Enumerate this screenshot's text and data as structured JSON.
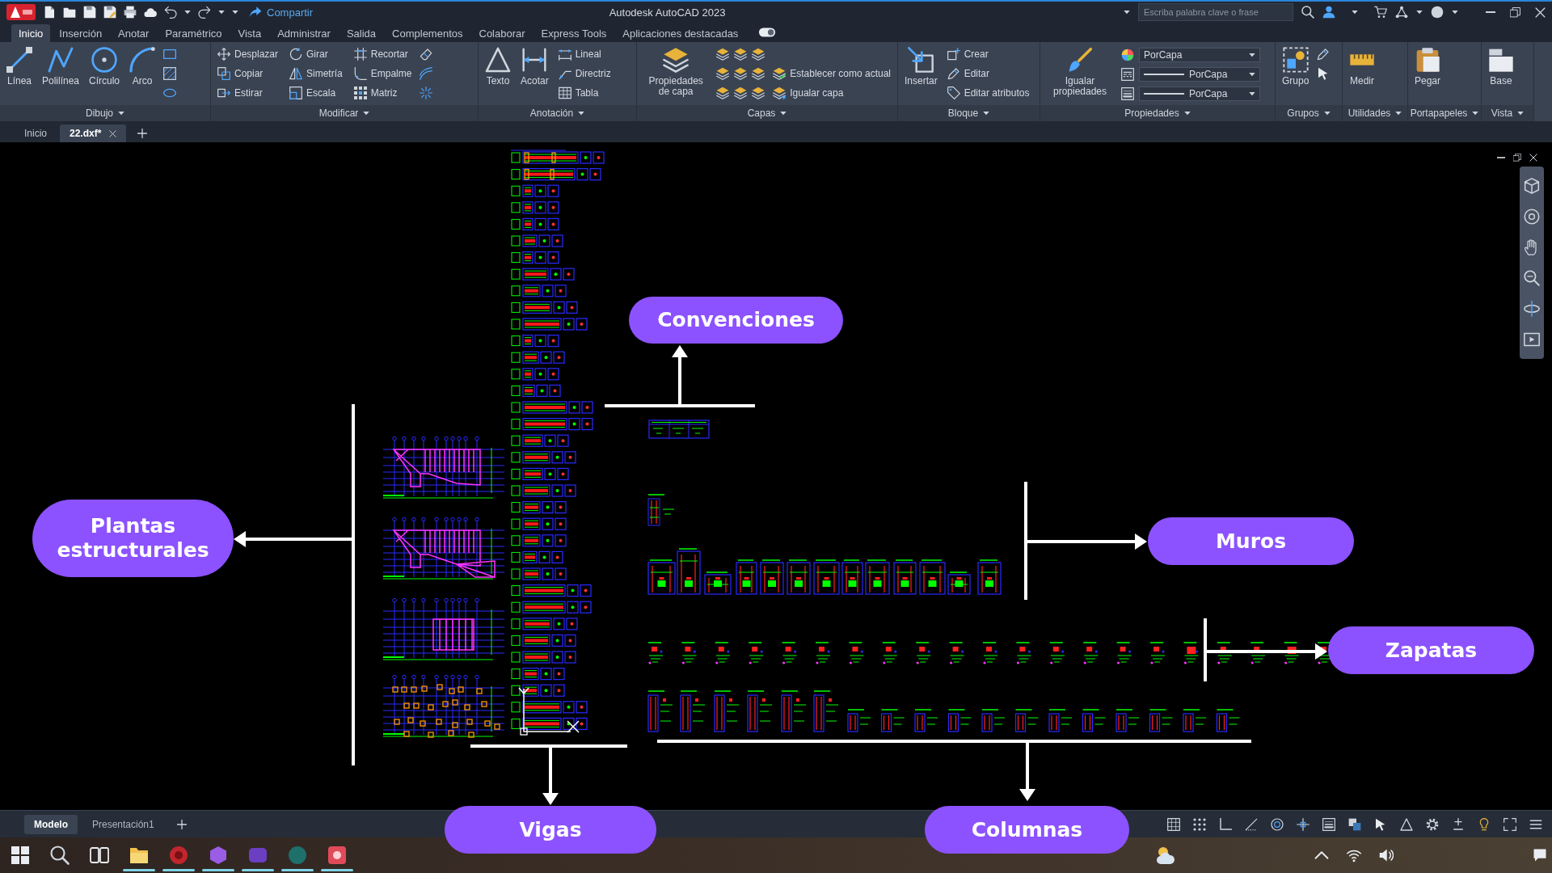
{
  "title_bar": {
    "share_label": "Compartir",
    "title": "Autodesk AutoCAD 2023",
    "search_placeholder": "Escriba palabra clave o frase"
  },
  "ribbon_tabs": [
    {
      "label": "Inicio",
      "selected": true
    },
    {
      "label": "Inserción",
      "selected": false
    },
    {
      "label": "Anotar",
      "selected": false
    },
    {
      "label": "Paramétrico",
      "selected": false
    },
    {
      "label": "Vista",
      "selected": false
    },
    {
      "label": "Administrar",
      "selected": false
    },
    {
      "label": "Salida",
      "selected": false
    },
    {
      "label": "Complementos",
      "selected": false
    },
    {
      "label": "Colaborar",
      "selected": false
    },
    {
      "label": "Express Tools",
      "selected": false
    },
    {
      "label": "Aplicaciones destacadas",
      "selected": false
    }
  ],
  "ribbon_panels": [
    {
      "title": "Dibujo",
      "tools": [
        {
          "kind": "large",
          "label": "Línea"
        },
        {
          "kind": "large",
          "label": "Polilínea"
        },
        {
          "kind": "large",
          "label": "Círculo"
        },
        {
          "kind": "large",
          "label": "Arco"
        }
      ]
    },
    {
      "title": "Modificar",
      "tools": [
        {
          "kind": "small",
          "label": "Desplazar"
        },
        {
          "kind": "small",
          "label": "Copiar"
        },
        {
          "kind": "small",
          "label": "Estirar"
        },
        {
          "kind": "small",
          "label": "Girar"
        },
        {
          "kind": "small",
          "label": "Simetría"
        },
        {
          "kind": "small",
          "label": "Escala"
        },
        {
          "kind": "small",
          "label": "Recortar"
        },
        {
          "kind": "small",
          "label": "Empalme"
        },
        {
          "kind": "small",
          "label": "Matriz"
        }
      ]
    },
    {
      "title": "Anotación",
      "tools": [
        {
          "kind": "large",
          "label": "Texto"
        },
        {
          "kind": "large",
          "label": "Acotar"
        },
        {
          "kind": "small",
          "label": "Lineal"
        },
        {
          "kind": "small",
          "label": "Directriz"
        },
        {
          "kind": "small",
          "label": "Tabla"
        }
      ]
    },
    {
      "title": "Capas",
      "tools": [
        {
          "kind": "large",
          "label": "Propiedades de capa"
        },
        {
          "kind": "small",
          "label": "Establecer como actual"
        },
        {
          "kind": "small",
          "label": "Igualar capa"
        }
      ]
    },
    {
      "title": "Bloque",
      "tools": [
        {
          "kind": "large",
          "label": "Insertar"
        },
        {
          "kind": "small",
          "label": "Crear"
        },
        {
          "kind": "small",
          "label": "Editar"
        },
        {
          "kind": "small",
          "label": "Editar atributos"
        }
      ]
    },
    {
      "title": "Propiedades",
      "tools": [
        {
          "kind": "large",
          "label": "Igualar propiedades"
        },
        {
          "kind": "dropdown",
          "label": "PorCapa"
        },
        {
          "kind": "dropdown",
          "label": "PorCapa"
        },
        {
          "kind": "dropdown",
          "label": "PorCapa"
        }
      ]
    },
    {
      "title": "Grupos",
      "tools": [
        {
          "kind": "large",
          "label": "Grupo"
        }
      ]
    },
    {
      "title": "Utilidades",
      "tools": [
        {
          "kind": "large",
          "label": "Medir"
        }
      ]
    },
    {
      "title": "Portapapeles",
      "tools": [
        {
          "kind": "large",
          "label": "Pegar"
        }
      ]
    },
    {
      "title": "Vista",
      "tools": [
        {
          "kind": "large",
          "label": "Base"
        }
      ]
    }
  ],
  "file_tabs": [
    {
      "label": "Inicio",
      "selected": false
    },
    {
      "label": "22.dxf*",
      "selected": true
    }
  ],
  "drawing_area": {
    "callouts": [
      {
        "label": "Convenciones"
      },
      {
        "label": "Plantas estructurales"
      },
      {
        "label": "Muros"
      },
      {
        "label": "Zapatas"
      },
      {
        "label": "Vigas"
      },
      {
        "label": "Columnas"
      }
    ]
  },
  "layout_tabs": [
    {
      "label": "Modelo",
      "selected": true
    },
    {
      "label": "Presentación1",
      "selected": false
    }
  ]
}
